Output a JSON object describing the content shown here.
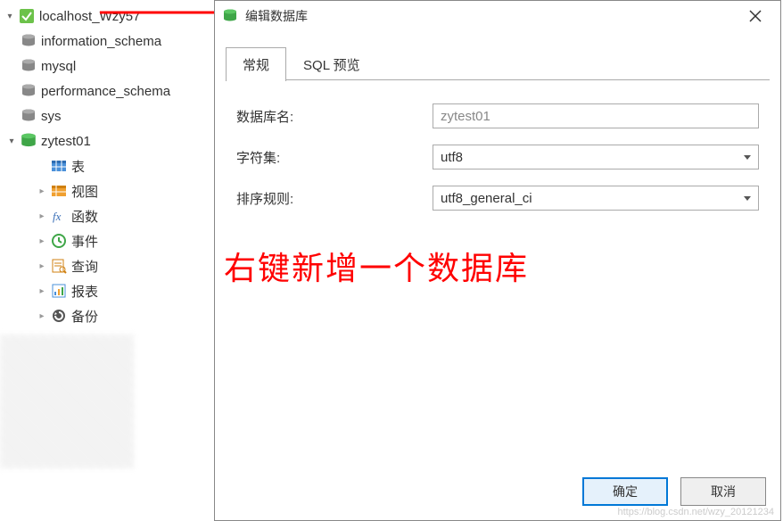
{
  "tree": {
    "connection": "localhost_Wzy57",
    "databases": [
      {
        "name": "information_schema"
      },
      {
        "name": "mysql"
      },
      {
        "name": "performance_schema"
      },
      {
        "name": "sys"
      },
      {
        "name": "zytest01",
        "expanded": true
      }
    ],
    "children": [
      {
        "label": "表"
      },
      {
        "label": "视图"
      },
      {
        "label": "函数"
      },
      {
        "label": "事件"
      },
      {
        "label": "查询"
      },
      {
        "label": "报表"
      },
      {
        "label": "备份"
      }
    ]
  },
  "dialog": {
    "title": "编辑数据库",
    "tabs": {
      "general": "常规",
      "sql_preview": "SQL 预览"
    },
    "form": {
      "db_name_label": "数据库名:",
      "db_name_value": "zytest01",
      "charset_label": "字符集:",
      "charset_value": "utf8",
      "collation_label": "排序规则:",
      "collation_value": "utf8_general_ci"
    },
    "buttons": {
      "ok": "确定",
      "cancel": "取消"
    }
  },
  "annotation": "右键新增一个数据库",
  "watermark": "https://blog.csdn.net/wzy_20121234"
}
